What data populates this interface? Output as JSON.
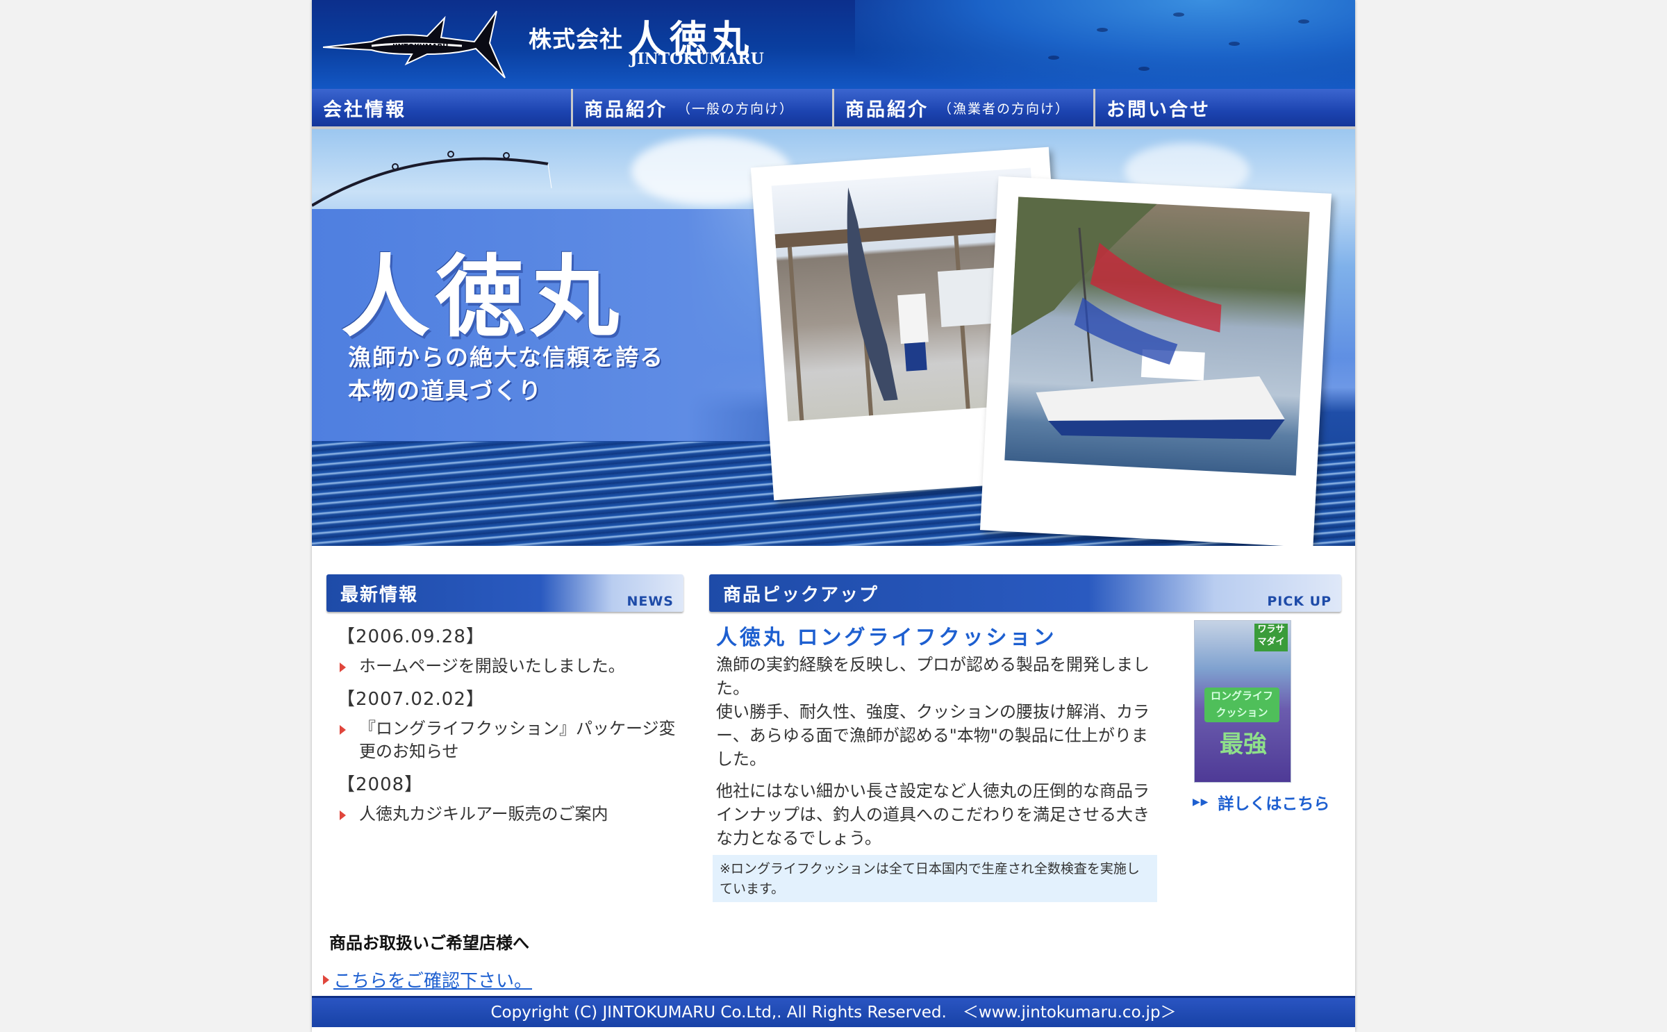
{
  "header": {
    "company_prefix": "株式会社",
    "company_name": "人徳丸",
    "company_roman": "JINTOKUMARU",
    "logo_icon": "marlin-logo-icon",
    "logo_text": "JINTOKUMARU"
  },
  "nav": {
    "items": [
      {
        "label": "会社情報",
        "sub": ""
      },
      {
        "label": "商品紹介",
        "sub": "（一般の方向け）"
      },
      {
        "label": "商品紹介",
        "sub": "（漁業者の方向け）"
      },
      {
        "label": "お問い合せ",
        "sub": ""
      }
    ]
  },
  "hero": {
    "title": "人徳丸",
    "tagline_1": "漁師からの絶大な信頼を誇る",
    "tagline_2": "本物の道具づくり"
  },
  "news": {
    "title": "最新情報",
    "tag": "NEWS",
    "entries": [
      {
        "date": "【2006.09.28】",
        "text": "ホームページを開設いたしました。"
      },
      {
        "date": "【2007.02.02】",
        "text": "『ロングライフクッション』パッケージ変更のお知らせ"
      },
      {
        "date": "【2008】",
        "text": "人徳丸カジキルアー販売のご案内"
      }
    ]
  },
  "pickup": {
    "title": "商品ピックアップ",
    "tag": "PICK UP",
    "product_name": "人徳丸 ロングライフクッション",
    "para_1": "漁師の実釣経験を反映し、プロが認める製品を開発しました。",
    "para_2": "使い勝手、耐久性、強度、クッションの腰抜け解消、カラー、あらゆる面で漁師が認める\"本物\"の製品に仕上がりました。",
    "para_3": "他社にはない細かい長さ設定など人徳丸の圧倒的な商品ラインナップは、釣人の道具へのこだわりを満足させる大きな力となるでしょう。",
    "note": "※ロングライフクッションは全て日本国内で生産され全数検査を実施しています。",
    "product_image_label_top": "ワラサ マダイ",
    "product_image_label_mid": "ロングライフ クッション",
    "product_image_label_big": "最強",
    "details_link": "詳しくはこちら"
  },
  "dealer": {
    "heading": "商品お取扱いご希望店様へ",
    "link": "こちらをご確認下さい。"
  },
  "footer": {
    "copyright": "Copyright (C) JINTOKUMARU Co.Ltd,. All Rights Reserved.　＜www.jintokumaru.co.jp＞"
  }
}
